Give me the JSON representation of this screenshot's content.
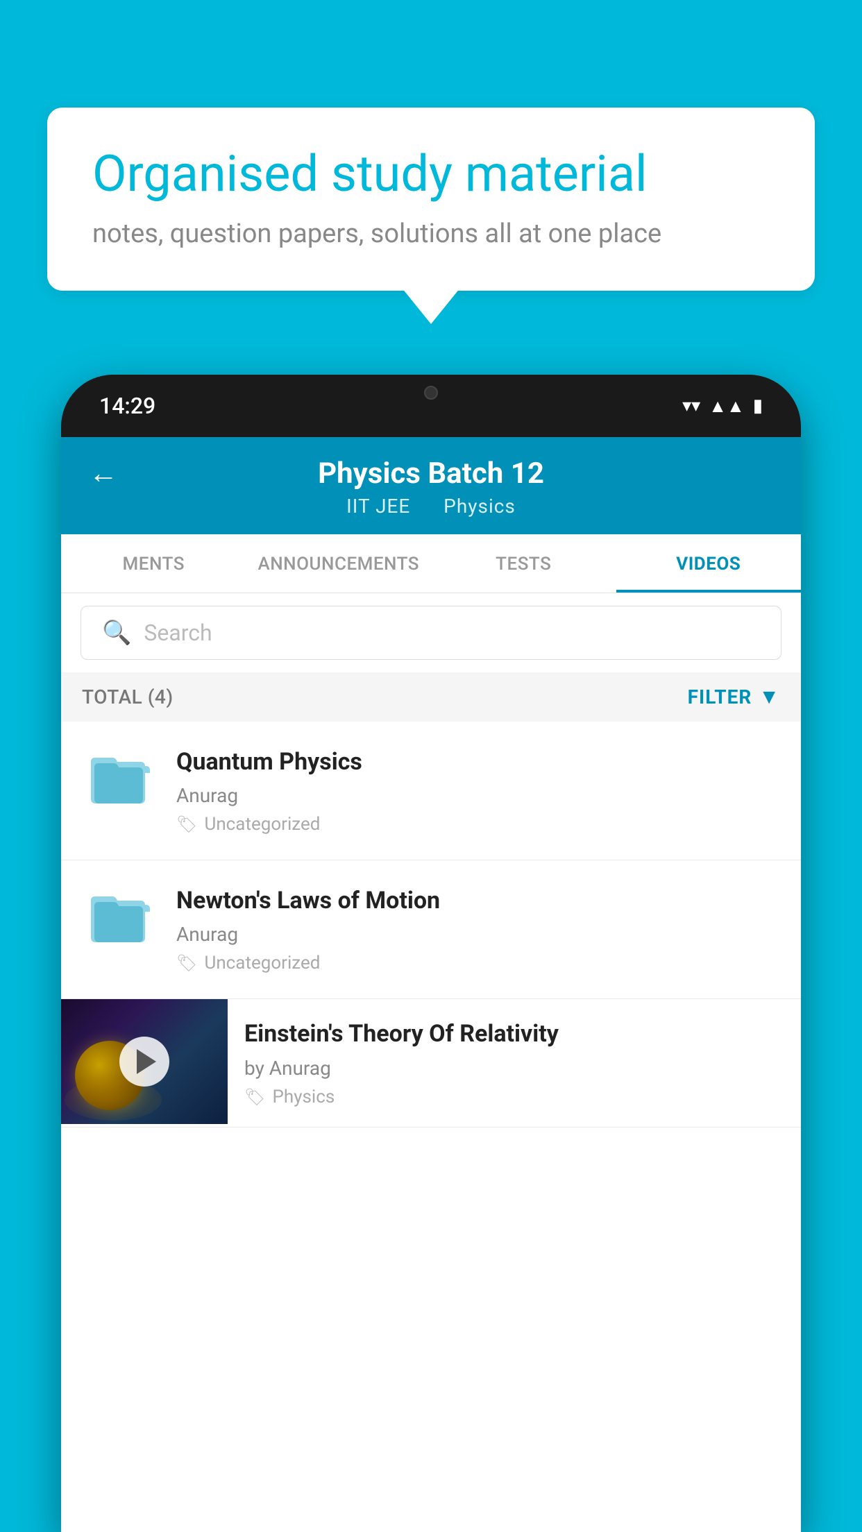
{
  "background_color": "#00b8d9",
  "speech_bubble": {
    "heading": "Organised study material",
    "subtext": "notes, question papers, solutions all at one place"
  },
  "phone": {
    "time": "14:29",
    "header": {
      "title": "Physics Batch 12",
      "subtitle_part1": "IIT JEE",
      "subtitle_part2": "Physics"
    },
    "tabs": [
      {
        "label": "MENTS",
        "active": false
      },
      {
        "label": "ANNOUNCEMENTS",
        "active": false
      },
      {
        "label": "TESTS",
        "active": false
      },
      {
        "label": "VIDEOS",
        "active": true
      }
    ],
    "search": {
      "placeholder": "Search"
    },
    "filter": {
      "total_label": "TOTAL (4)",
      "filter_label": "FILTER"
    },
    "videos": [
      {
        "id": 1,
        "title": "Quantum Physics",
        "author": "Anurag",
        "tag": "Uncategorized",
        "has_thumbnail": false
      },
      {
        "id": 2,
        "title": "Newton's Laws of Motion",
        "author": "Anurag",
        "tag": "Uncategorized",
        "has_thumbnail": false
      },
      {
        "id": 3,
        "title": "Einstein's Theory Of Relativity",
        "author": "by Anurag",
        "tag": "Physics",
        "has_thumbnail": true
      }
    ]
  }
}
